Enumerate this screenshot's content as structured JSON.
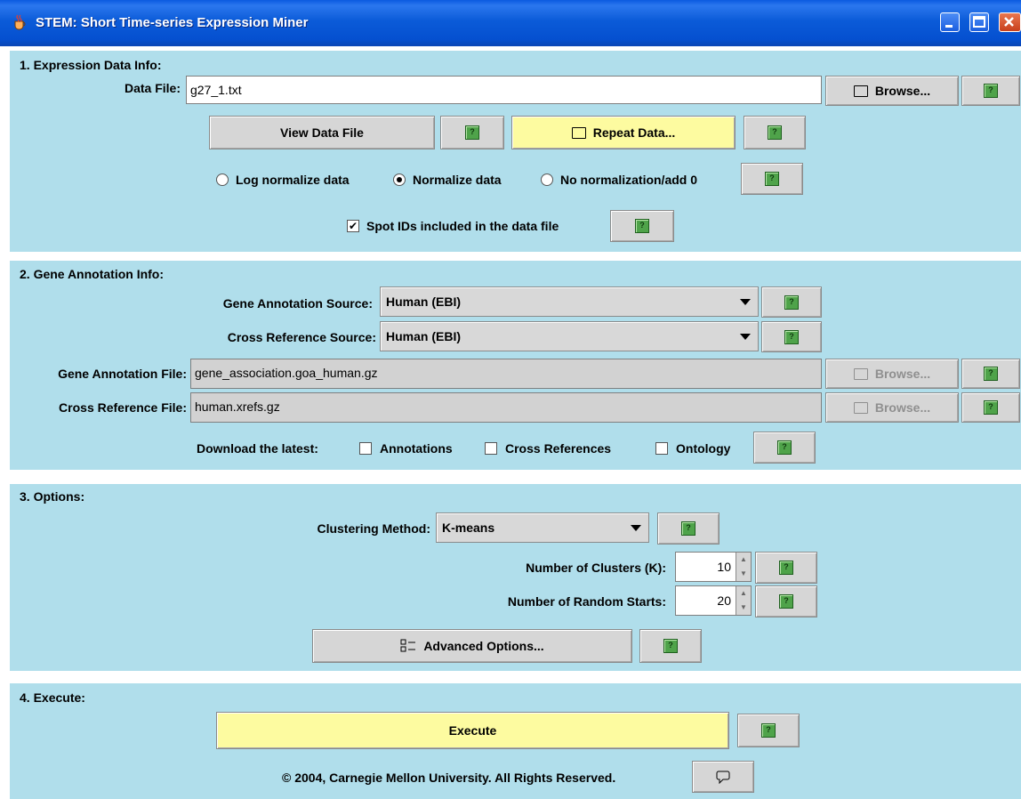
{
  "window": {
    "title": "STEM: Short Time-series Expression Miner"
  },
  "help_glyph": "?",
  "section1": {
    "title": "1. Expression Data Info:",
    "data_file_label": "Data File:",
    "data_file_value": "g27_1.txt",
    "browse_label": "Browse...",
    "view_data_file_label": "View Data File",
    "repeat_data_label": "Repeat Data...",
    "normalization": {
      "options": [
        "Log normalize data",
        "Normalize data",
        "No normalization/add 0"
      ],
      "selected": "Normalize data"
    },
    "spot_ids_label": "Spot IDs included in the data file",
    "spot_ids_checked": true
  },
  "section2": {
    "title": "2. Gene Annotation Info:",
    "gene_annotation_source_label": "Gene Annotation Source:",
    "gene_annotation_source_value": "Human (EBI)",
    "cross_reference_source_label": "Cross Reference Source:",
    "cross_reference_source_value": "Human (EBI)",
    "gene_annotation_file_label": "Gene Annotation File:",
    "gene_annotation_file_value": "gene_association.goa_human.gz",
    "cross_reference_file_label": "Cross Reference File:",
    "cross_reference_file_value": "human.xrefs.gz",
    "browse_label": "Browse...",
    "download_latest_label": "Download the latest:",
    "download_options": [
      "Annotations",
      "Cross References",
      "Ontology"
    ]
  },
  "section3": {
    "title": "3. Options:",
    "clustering_method_label": "Clustering Method:",
    "clustering_method_value": "K-means",
    "num_clusters_label": "Number of Clusters (K):",
    "num_clusters_value": "10",
    "num_random_starts_label": "Number of Random Starts:",
    "num_random_starts_value": "20",
    "advanced_options_label": "Advanced Options..."
  },
  "section4": {
    "title": "4. Execute:",
    "execute_label": "Execute",
    "copyright": "© 2004, Carnegie Mellon University.  All Rights Reserved."
  },
  "colors": {
    "panel_bg": "#b0deeb",
    "titlebar_blue": "#0b5bd8",
    "highlight_yellow": "#fdfba0"
  }
}
